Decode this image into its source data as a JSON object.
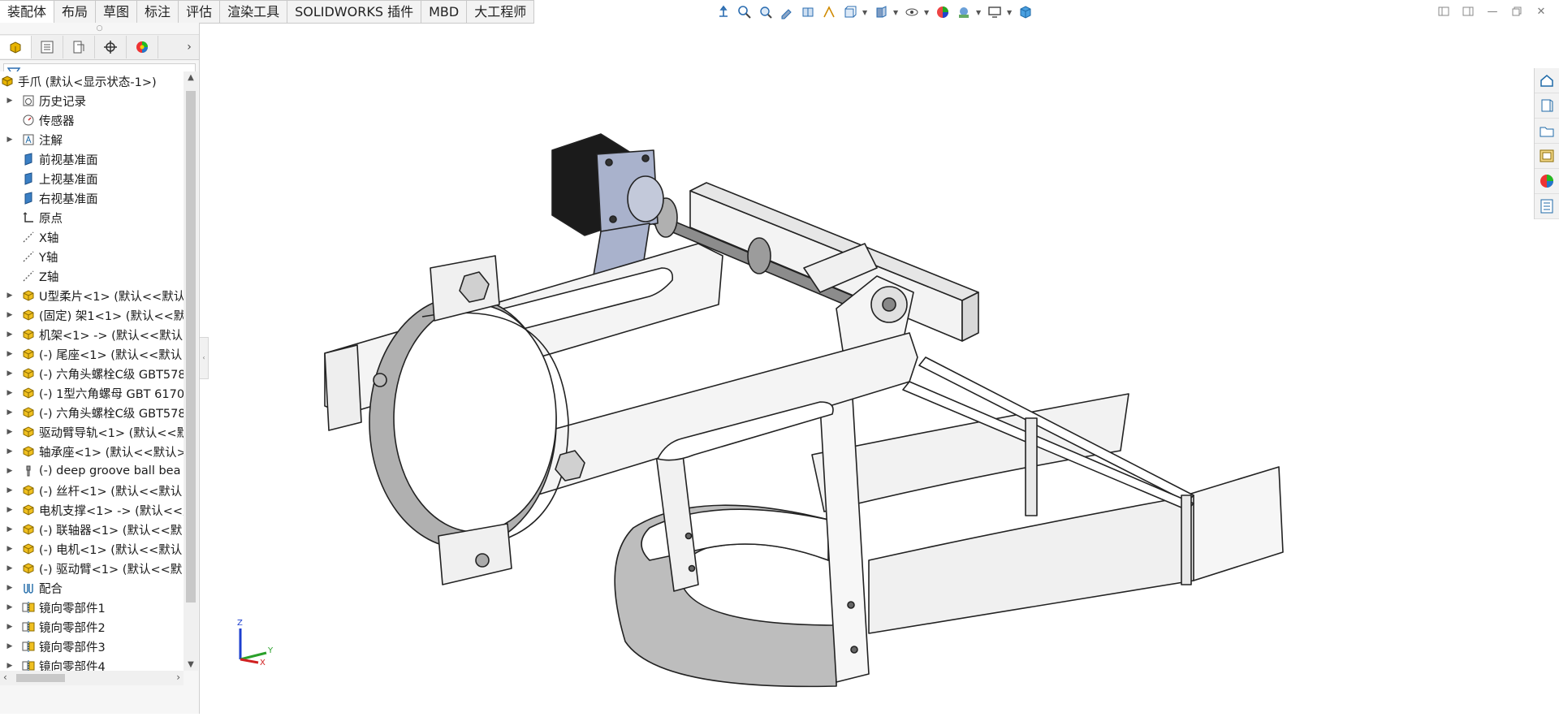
{
  "tabs": [
    "装配体",
    "布局",
    "草图",
    "标注",
    "评估",
    "渲染工具",
    "SOLIDWORKS 插件",
    "MBD",
    "大工程师"
  ],
  "active_tab": "装配体",
  "view_toolbar_icons": [
    "view-orientation-icon",
    "zoom-fit-icon",
    "zoom-area-icon",
    "previous-view-icon",
    "section-view-icon",
    "dynamic-annotation-icon",
    "view-type-icon",
    "display-style-icon",
    "hide-show-icon",
    "edit-appearance-icon",
    "apply-scene-icon",
    "view-settings-icon",
    "cube-icon"
  ],
  "panel_tabs": [
    "featuremanager-icon",
    "propertymanager-icon",
    "configuration-icon",
    "dimxpert-icon",
    "appearance-icon"
  ],
  "tree": {
    "root": "手爪 (默认<显示状态-1>)",
    "items": [
      {
        "label": "历史记录",
        "icon": "history-icon",
        "expand": true
      },
      {
        "label": "传感器",
        "icon": "sensor-icon",
        "expand": false
      },
      {
        "label": "注解",
        "icon": "annotation-icon",
        "expand": true
      },
      {
        "label": "前视基准面",
        "icon": "plane-icon",
        "expand": false
      },
      {
        "label": "上视基准面",
        "icon": "plane-icon",
        "expand": false
      },
      {
        "label": "右视基准面",
        "icon": "plane-icon",
        "expand": false
      },
      {
        "label": "原点",
        "icon": "origin-icon",
        "expand": false
      },
      {
        "label": "X轴",
        "icon": "axis-icon",
        "expand": false
      },
      {
        "label": "Y轴",
        "icon": "axis-icon",
        "expand": false
      },
      {
        "label": "Z轴",
        "icon": "axis-icon",
        "expand": false
      },
      {
        "label": "U型柔片<1> (默认<<默认",
        "icon": "part-icon",
        "expand": true
      },
      {
        "label": "(固定) 架1<1> (默认<<默",
        "icon": "part-icon",
        "expand": true
      },
      {
        "label": "机架<1> -> (默认<<默认",
        "icon": "part-icon",
        "expand": true
      },
      {
        "label": "(-) 尾座<1> (默认<<默认",
        "icon": "part-icon",
        "expand": true
      },
      {
        "label": "(-) 六角头螺栓C级 GBT578",
        "icon": "part-icon",
        "expand": true
      },
      {
        "label": "(-) 1型六角螺母 GBT 6170",
        "icon": "part-icon",
        "expand": true
      },
      {
        "label": "(-) 六角头螺栓C级 GBT578",
        "icon": "part-icon",
        "expand": true
      },
      {
        "label": "驱动臂导轨<1> (默认<<默",
        "icon": "part-icon",
        "expand": true
      },
      {
        "label": "轴承座<1> (默认<<默认>_",
        "icon": "part-icon",
        "expand": true
      },
      {
        "label": "(-) deep groove ball bea",
        "icon": "toolbox-part-icon",
        "expand": true
      },
      {
        "label": "(-) 丝杆<1> (默认<<默认",
        "icon": "part-icon",
        "expand": true
      },
      {
        "label": "电机支撑<1> -> (默认<<默",
        "icon": "part-icon",
        "expand": true
      },
      {
        "label": "(-) 联轴器<1> (默认<<默",
        "icon": "part-icon",
        "expand": true
      },
      {
        "label": "(-) 电机<1> (默认<<默认",
        "icon": "part-icon",
        "expand": true
      },
      {
        "label": "(-) 驱动臂<1> (默认<<默",
        "icon": "part-icon",
        "expand": true
      },
      {
        "label": "配合",
        "icon": "mates-icon",
        "expand": true
      },
      {
        "label": "镜向零部件1",
        "icon": "mirror-component-icon",
        "expand": true
      },
      {
        "label": "镜向零部件2",
        "icon": "mirror-component-icon",
        "expand": true
      },
      {
        "label": "镜向零部件3",
        "icon": "mirror-component-icon",
        "expand": true
      },
      {
        "label": "镜向零部件4",
        "icon": "mirror-component-icon",
        "expand": true
      }
    ]
  },
  "task_pane_icons": [
    "home-icon",
    "design-library-icon",
    "file-explorer-icon",
    "view-palette-icon",
    "appearances-icon",
    "custom-properties-icon"
  ],
  "triad": {
    "z": "Z",
    "y": "Y",
    "x": "X"
  },
  "colors": {
    "part_yellow": "#e8b400",
    "plane_blue": "#3a7fc4",
    "motor_black": "#1b1b1b",
    "bracket_blue": "#a9b2cc"
  }
}
